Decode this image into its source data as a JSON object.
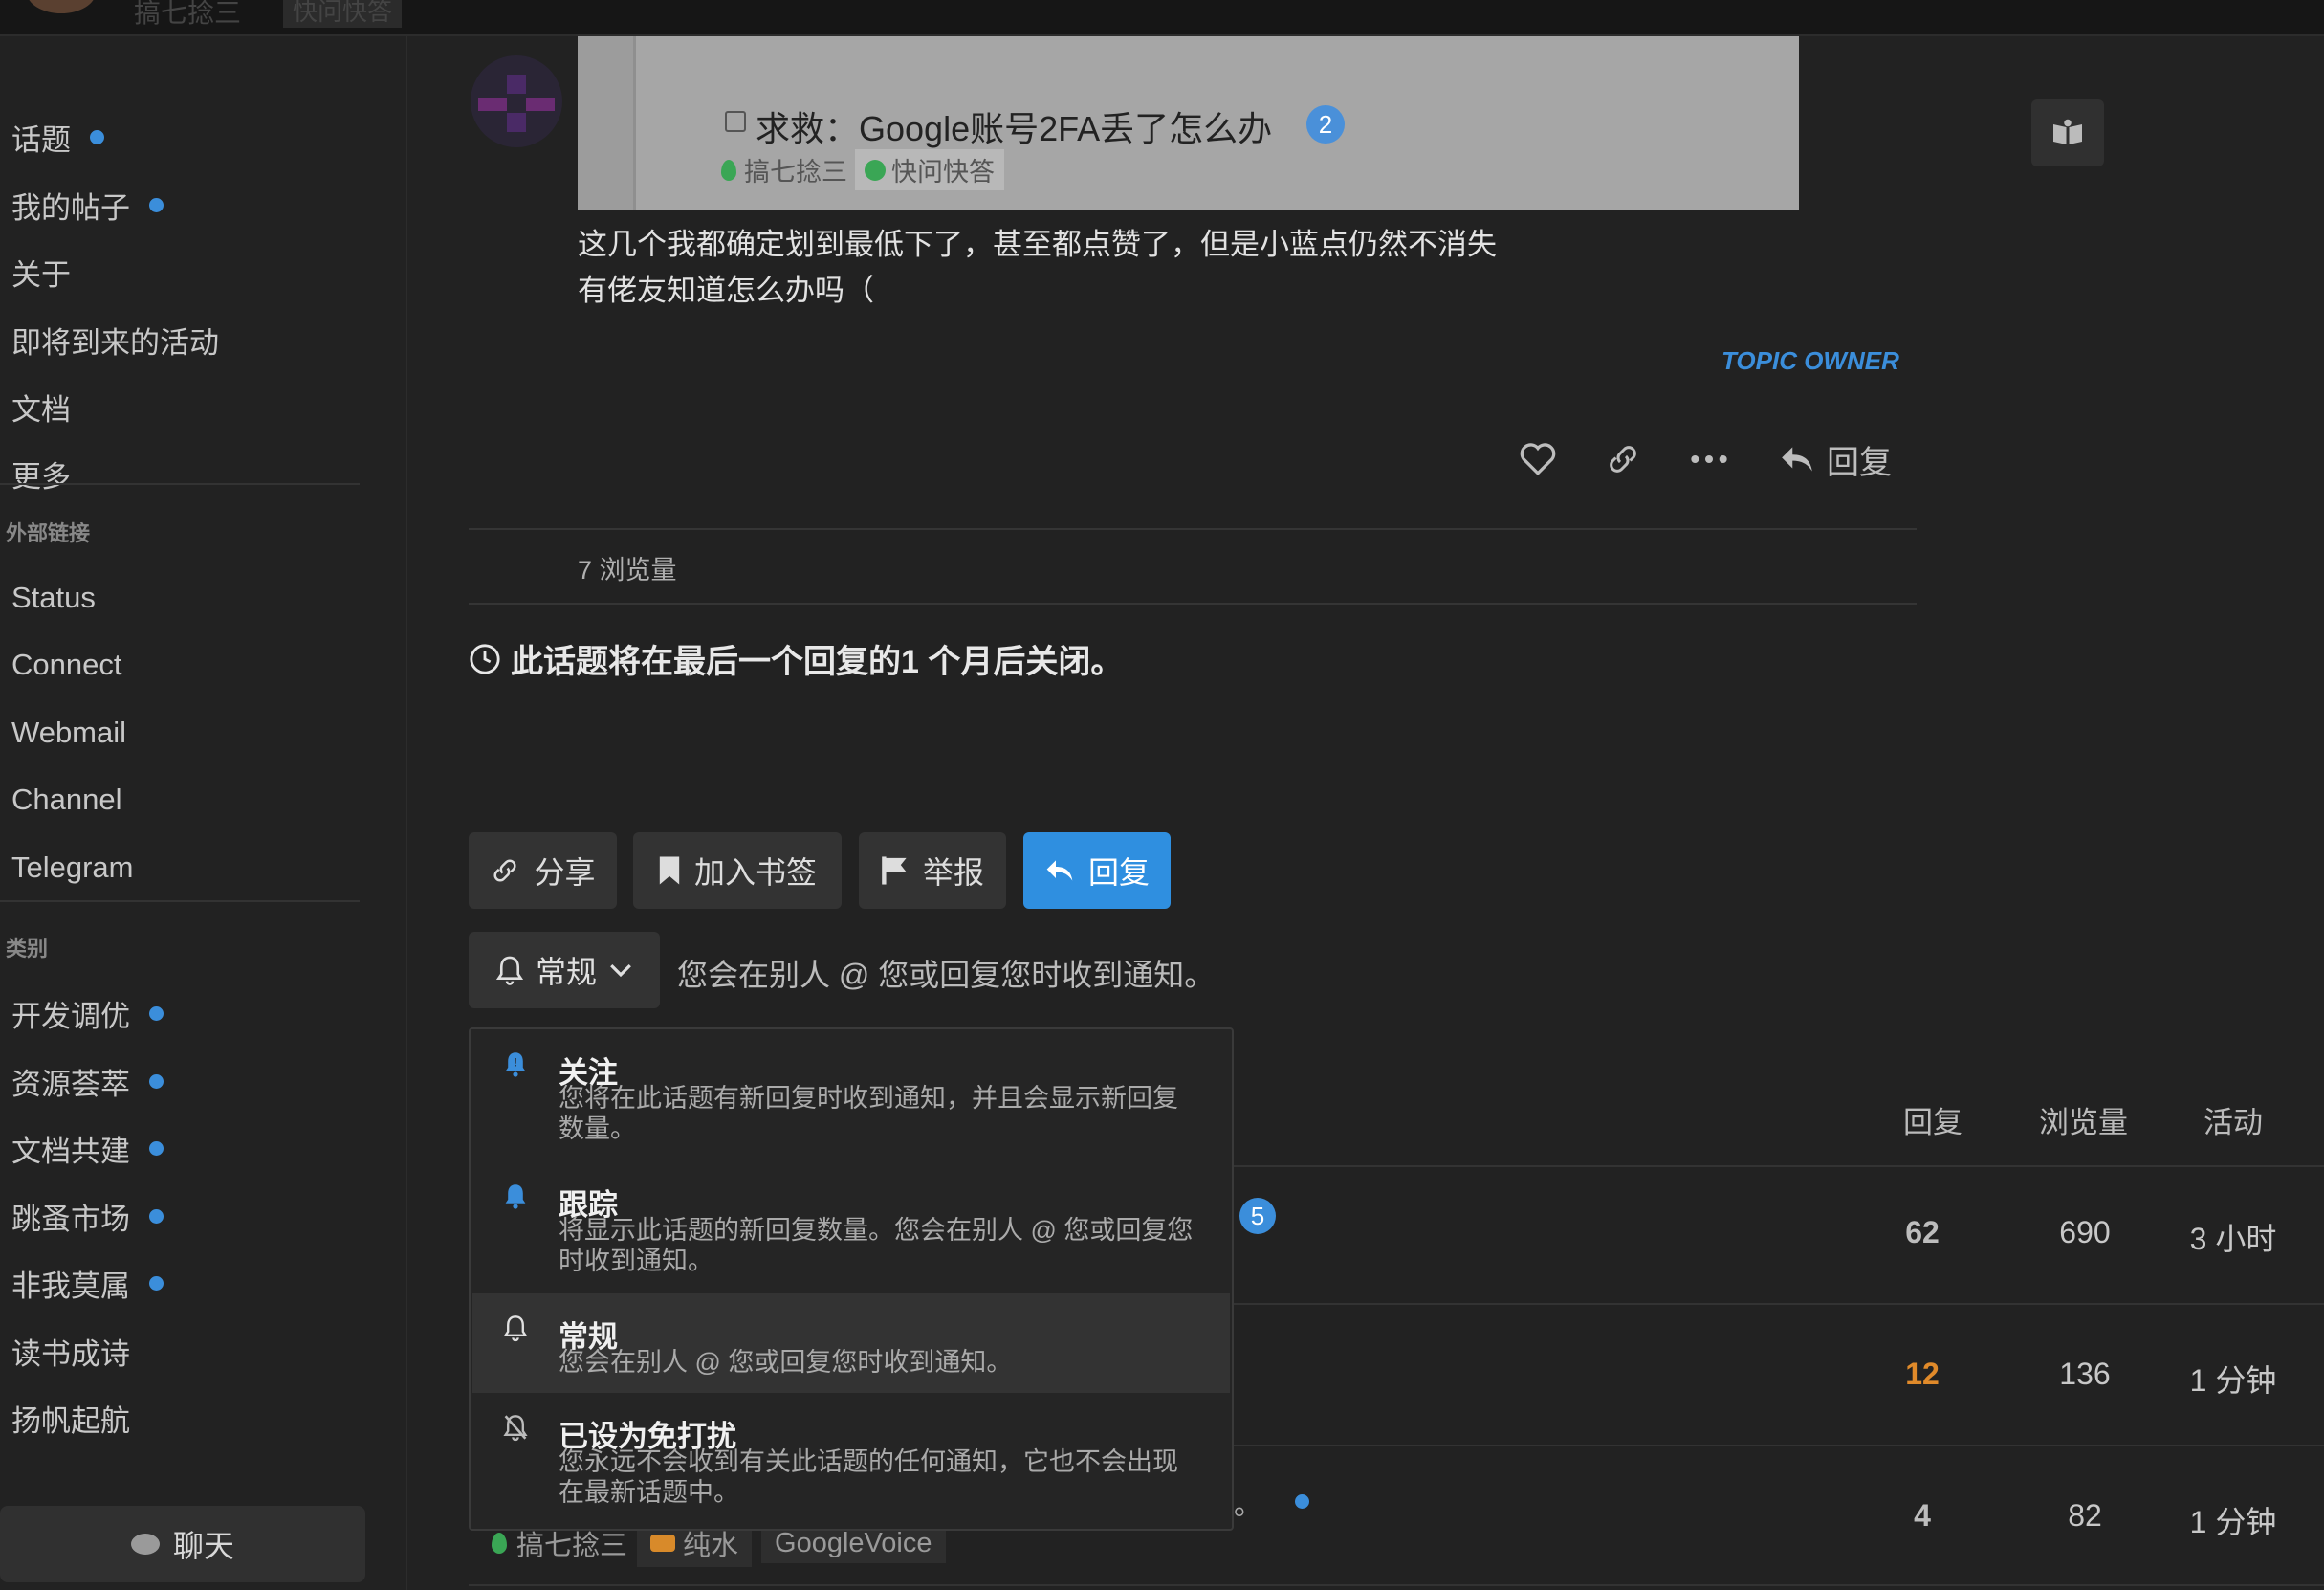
{
  "topbar": {
    "username_peek": "搞七捻三",
    "tag_peek": "快问快答"
  },
  "sidebar": {
    "items": [
      {
        "label": "话题",
        "dot": true
      },
      {
        "label": "我的帖子",
        "dot": true
      },
      {
        "label": "关于",
        "dot": false
      },
      {
        "label": "即将到来的活动",
        "dot": false
      },
      {
        "label": "文档",
        "dot": false
      },
      {
        "label": "更多",
        "dot": false
      }
    ],
    "links_header": "外部链接",
    "links": [
      "Status",
      "Connect",
      "Webmail",
      "Channel",
      "Telegram"
    ],
    "categories_header": "类别",
    "categories": [
      {
        "label": "开发调优",
        "dot": true
      },
      {
        "label": "资源荟萃",
        "dot": true
      },
      {
        "label": "文档共建",
        "dot": true
      },
      {
        "label": "跳蚤市场",
        "dot": true
      },
      {
        "label": "非我莫属",
        "dot": true
      },
      {
        "label": "读书成诗",
        "dot": false
      },
      {
        "label": "扬帆起航",
        "dot": false
      }
    ],
    "chat_label": "聊天"
  },
  "post": {
    "quote": {
      "title": "求救：Google账号2FA丢了怎么办",
      "count": "2",
      "category": "搞七捻三",
      "tag": "快问快答"
    },
    "body_lines": [
      "这几个我都确定划到最低下了，甚至都点赞了，但是小蓝点仍然不消失",
      "有佬友知道怎么办吗（"
    ],
    "owner_label": "TOPIC OWNER",
    "reply_label": "回复",
    "views": "7 浏览量"
  },
  "close_notice": "此话题将在最后一个回复的1 个月后关闭。",
  "footer_buttons": {
    "share": "分享",
    "bookmark": "加入书签",
    "flag": "举报",
    "reply": "回复"
  },
  "notification": {
    "current": "常规",
    "current_desc": "您会在别人 @ 您或回复您时收到通知。",
    "options": [
      {
        "title": "关注",
        "desc": "您将在此话题有新回复时收到通知，并且会显示新回复数量。"
      },
      {
        "title": "跟踪",
        "desc": "将显示此话题的新回复数量。您会在别人 @ 您或回复您时收到通知。"
      },
      {
        "title": "常规",
        "desc": "您会在别人 @ 您或回复您时收到通知。"
      },
      {
        "title": "已设为免打扰",
        "desc": "您永远不会收到有关此话题的任何通知，它也不会出现在最新话题中。"
      }
    ]
  },
  "suggested": {
    "headers": {
      "replies": "回复",
      "views": "浏览量",
      "activity": "活动"
    },
    "rows": [
      {
        "badge": "5",
        "replies": "62",
        "views": "690",
        "activity": "3 小时"
      },
      {
        "replies": "12",
        "views": "136",
        "activity": "1 分钟"
      },
      {
        "title_tail": "。",
        "replies": "4",
        "views": "82",
        "activity": "1 分钟",
        "category": "搞七捻三",
        "tag1": "纯水",
        "tag2": "GoogleVoice"
      }
    ]
  },
  "colors": {
    "accent": "#3b8edb",
    "primary_button": "#2f8fe0",
    "hot": "#e08a2a",
    "background": "#222222"
  }
}
